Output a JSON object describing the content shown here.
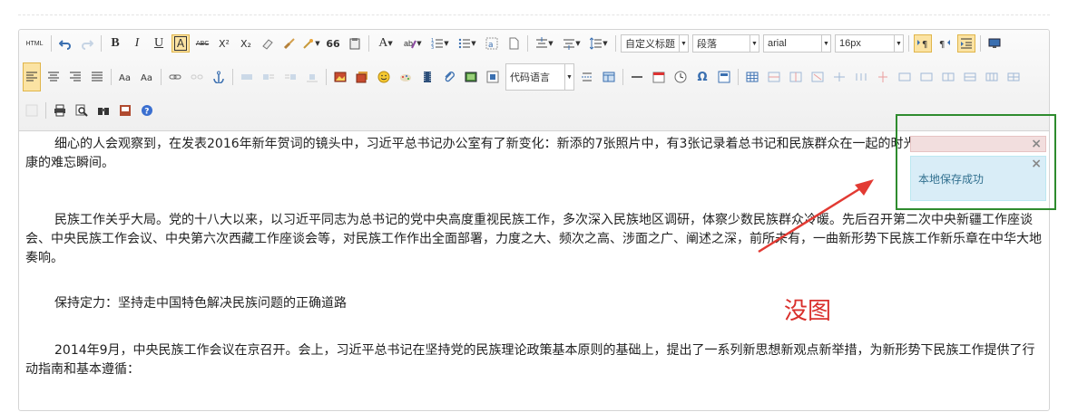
{
  "toolbar": {
    "row1": {
      "html_label": "HTML",
      "bold": "B",
      "italic": "I",
      "underline": "U",
      "font_border": "A",
      "strike": "ABC",
      "superscript": "X²",
      "subscript": "X₂",
      "blockquote": "66",
      "forecolor": "A",
      "heading_combo": "自定义标题",
      "paragraph_combo": "段落",
      "font_family_combo": "arial",
      "font_size_combo": "16px"
    },
    "row2": {
      "code_lang_combo": "代码语言",
      "omega": "Ω"
    }
  },
  "content": {
    "paragraphs": [
      "细心的人会观察到，在发表2016年新年贺词的镜头中，习近平总书记办公室有了新变化：新添的7张照片中，有3张记录着总书记和民族群众在一起的时光，一起谋发展、话小康的难忘瞬间。",
      "民族工作关乎大局。党的十八大以来，以习近平同志为总书记的党中央高度重视民族工作，多次深入民族地区调研，体察少数民族群众冷暖。先后召开第二次中央新疆工作座谈会、中央民族工作会议、中央第六次西藏工作座谈会等，对民族工作作出全面部署，力度之大、频次之高、涉面之广、阐述之深，前所未有，一曲新形势下民族工作新乐章在中华大地奏响。",
      "保持定力：坚持走中国特色解决民族问题的正确道路",
      "2014年9月，中央民族工作会议在京召开。会上，习近平总书记在坚持党的民族理论政策基本原则的基础上，提出了一系列新思想新观点新举措，为新形势下民族工作提供了行动指南和基本遵循："
    ]
  },
  "notifications": {
    "info_message": "本地保存成功",
    "close_symbol": "×"
  },
  "annotation": {
    "text": "没图",
    "color": "#d9302c",
    "box_color": "#2e8b2e"
  }
}
